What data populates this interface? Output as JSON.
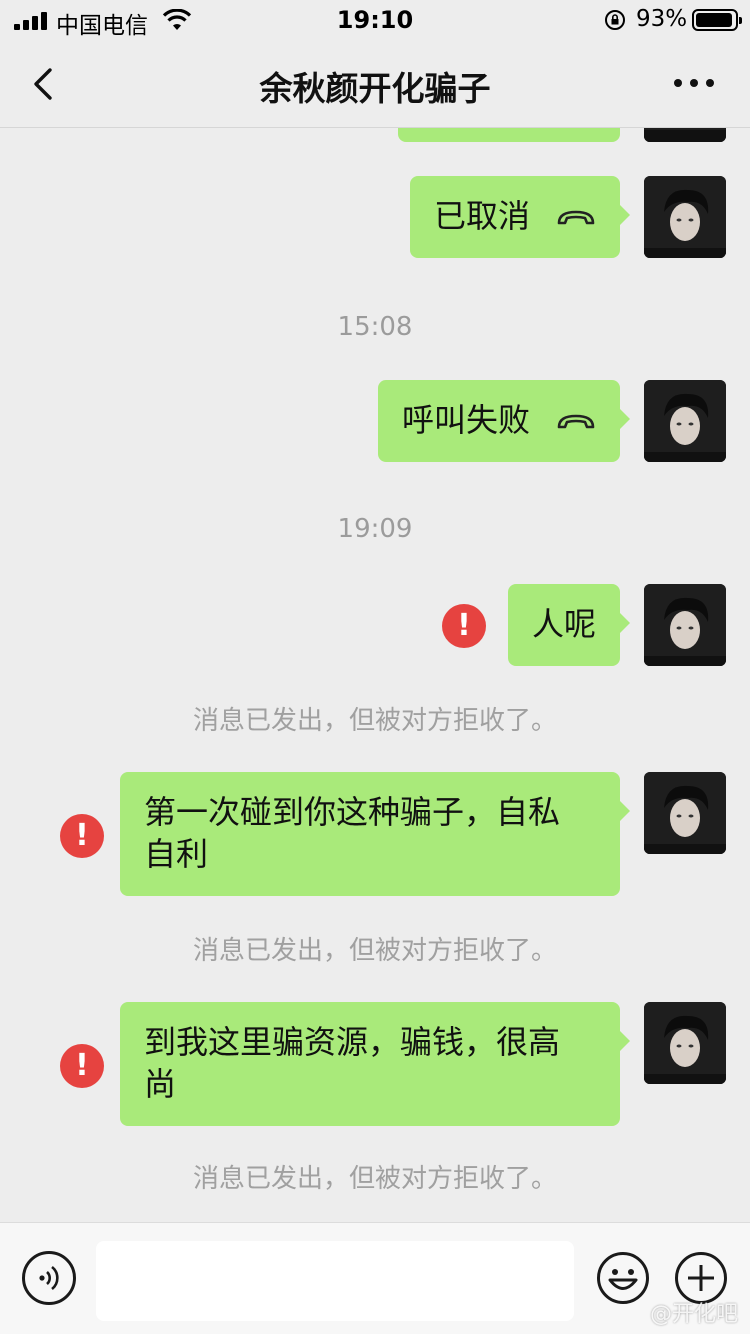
{
  "status_bar": {
    "carrier": "中国电信",
    "time": "19:10",
    "battery_percent": "93%",
    "battery_level": 0.93
  },
  "nav": {
    "title": "余秋颜开化骗子"
  },
  "messages": [
    {
      "text": "已取消",
      "type": "call",
      "status": "sent"
    },
    {
      "timestamp": "15:08"
    },
    {
      "text": "呼叫失败",
      "type": "call",
      "status": "sent"
    },
    {
      "timestamp": "19:09"
    },
    {
      "text": "人呢",
      "type": "text",
      "status": "rejected",
      "note": "消息已发出，但被对方拒收了。"
    },
    {
      "text_line1": "第一次碰到你这种骗子，自私",
      "text_line2": "自利",
      "type": "text",
      "status": "rejected",
      "note": "消息已发出，但被对方拒收了。"
    },
    {
      "text_line1": "到我这里骗资源，骗钱，很高",
      "text_line2": "尚",
      "type": "text",
      "status": "rejected",
      "note": "消息已发出，但被对方拒收了。"
    }
  ],
  "colors": {
    "background": "#ededed",
    "bubble_sent": "#a9ea7a",
    "error": "#e64340",
    "meta_text": "#9b9b9b"
  },
  "icons": {
    "back": "chevron-left-icon",
    "more": "more-dots-icon",
    "call": "phone-hangup-icon",
    "error": "exclamation-icon",
    "voice": "voice-icon",
    "emoji": "emoji-icon",
    "plus": "plus-icon"
  },
  "watermark": "@开化吧"
}
